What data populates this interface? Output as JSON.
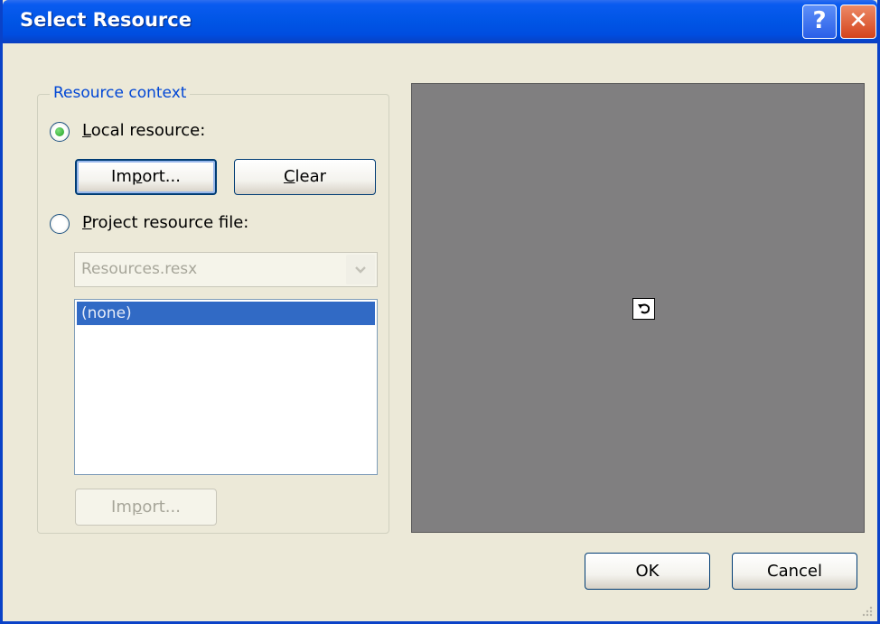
{
  "window": {
    "title": "Select Resource",
    "help_label": "?",
    "close_label": "✕"
  },
  "resource_context": {
    "legend": "Resource context",
    "local_resource": {
      "label_first": "L",
      "label_rest": "ocal resource:",
      "selected": true
    },
    "import_button": {
      "label_pre": "Im",
      "label_accel": "p",
      "label_post": "ort..."
    },
    "clear_button": {
      "label_accel": "C",
      "label_post": "lear"
    },
    "project_resource": {
      "label_first": "P",
      "label_rest": "roject resource file:",
      "selected": false
    },
    "file_combo": {
      "value": "Resources.resx",
      "arrow_icon": "chevron-down-icon"
    },
    "resource_list": {
      "items": [
        "(none)"
      ]
    },
    "project_import_button": {
      "label_pre": "Im",
      "label_accel": "p",
      "label_post": "ort..."
    }
  },
  "preview": {
    "icon": "undo-icon",
    "glyph": "↶"
  },
  "footer": {
    "ok_label": "OK",
    "cancel_label": "Cancel"
  },
  "colors": {
    "titlebar": "#0055e5",
    "legend": "#0046d5",
    "selection": "#316ac5",
    "preview_bg": "#807f80"
  }
}
